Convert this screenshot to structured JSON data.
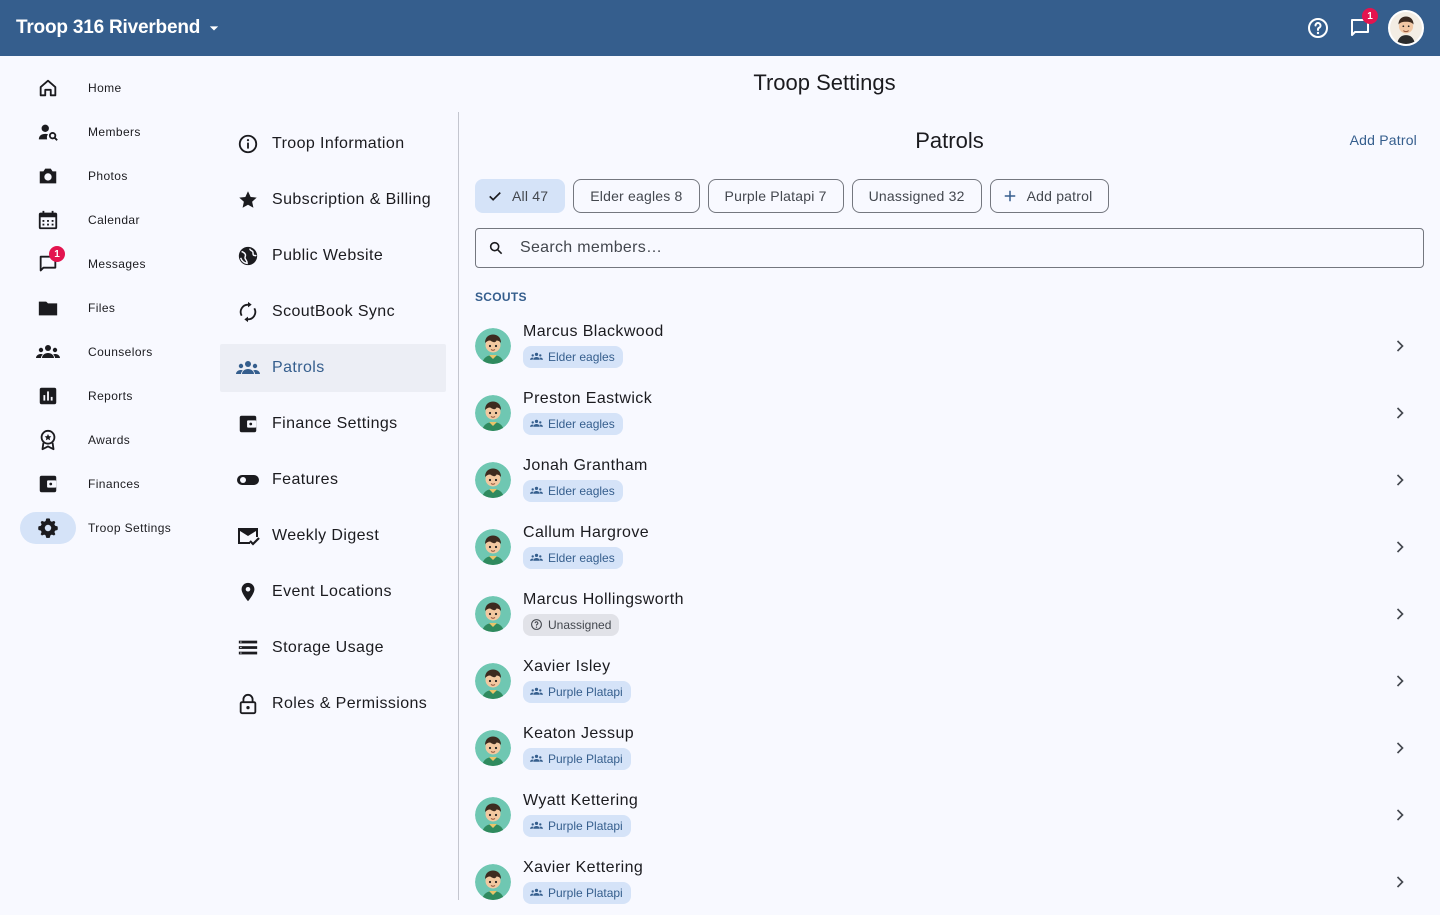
{
  "topbar": {
    "troop_name": "Troop 316 Riverbend",
    "notifications_count": "1"
  },
  "nav": {
    "items": [
      {
        "label": "Home",
        "icon": "home-icon"
      },
      {
        "label": "Members",
        "icon": "person-search-icon"
      },
      {
        "label": "Photos",
        "icon": "camera-icon"
      },
      {
        "label": "Calendar",
        "icon": "calendar-icon"
      },
      {
        "label": "Messages",
        "icon": "chat-icon",
        "badge": "1"
      },
      {
        "label": "Files",
        "icon": "folder-icon"
      },
      {
        "label": "Counselors",
        "icon": "groups-icon"
      },
      {
        "label": "Reports",
        "icon": "bar-chart-icon"
      },
      {
        "label": "Awards",
        "icon": "award-icon"
      },
      {
        "label": "Finances",
        "icon": "wallet-icon"
      },
      {
        "label": "Troop Settings",
        "icon": "gear-icon",
        "active": true
      }
    ]
  },
  "page": {
    "title": "Troop Settings"
  },
  "settings_menu": {
    "items": [
      {
        "label": "Troop Information",
        "icon": "info-icon"
      },
      {
        "label": "Subscription & Billing",
        "icon": "star-icon"
      },
      {
        "label": "Public Website",
        "icon": "globe-icon"
      },
      {
        "label": "ScoutBook Sync",
        "icon": "sync-icon"
      },
      {
        "label": "Patrols",
        "icon": "groups-icon",
        "active": true
      },
      {
        "label": "Finance Settings",
        "icon": "wallet-icon"
      },
      {
        "label": "Features",
        "icon": "toggle-icon"
      },
      {
        "label": "Weekly Digest",
        "icon": "mail-check-icon"
      },
      {
        "label": "Event Locations",
        "icon": "location-pin-icon"
      },
      {
        "label": "Storage Usage",
        "icon": "storage-icon"
      },
      {
        "label": "Roles & Permissions",
        "icon": "lock-icon"
      }
    ]
  },
  "patrols": {
    "title": "Patrols",
    "add_patrol_link": "Add Patrol",
    "chips": [
      {
        "label": "All 47",
        "selected": true
      },
      {
        "label": "Elder eagles 8"
      },
      {
        "label": "Purple Platapi 7"
      },
      {
        "label": "Unassigned 32"
      },
      {
        "label": "Add patrol",
        "add": true
      }
    ],
    "search_placeholder": "Search members…",
    "section_label": "SCOUTS",
    "members": [
      {
        "name": "Marcus Blackwood",
        "patrol": "Elder eagles"
      },
      {
        "name": "Preston Eastwick",
        "patrol": "Elder eagles"
      },
      {
        "name": "Jonah Grantham",
        "patrol": "Elder eagles"
      },
      {
        "name": "Callum Hargrove",
        "patrol": "Elder eagles"
      },
      {
        "name": "Marcus Hollingsworth",
        "patrol": "Unassigned",
        "unassigned": true
      },
      {
        "name": "Xavier Isley",
        "patrol": "Purple Platapi"
      },
      {
        "name": "Keaton Jessup",
        "patrol": "Purple Platapi"
      },
      {
        "name": "Wyatt Kettering",
        "patrol": "Purple Platapi"
      },
      {
        "name": "Xavier Kettering",
        "patrol": "Purple Platapi"
      }
    ]
  },
  "colors": {
    "brand": "#355e8d",
    "active_bg": "#d5e3f8",
    "badge": "#e3144f",
    "background": "#f8f9ff"
  }
}
